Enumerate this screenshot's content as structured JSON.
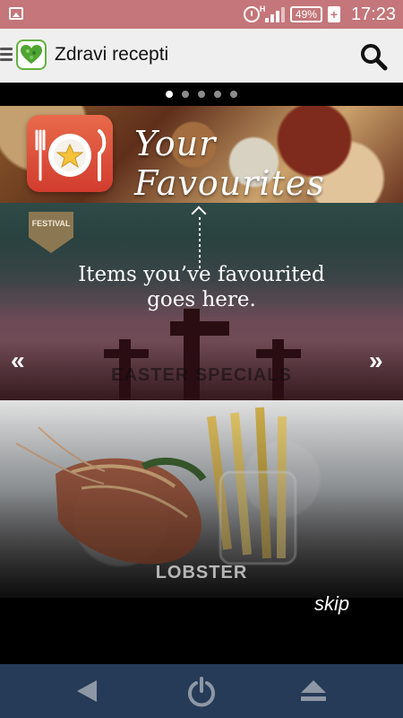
{
  "status_bar": {
    "time": "17:23",
    "battery_percent": "49%",
    "network_type": "H",
    "icons": [
      "image-notification-icon",
      "alarm-icon",
      "signal-icon",
      "battery-icon",
      "charging-icon"
    ]
  },
  "app_bar": {
    "title": "Zdravi recepti",
    "icons": [
      "menu-icon",
      "app-logo-icon",
      "search-icon"
    ]
  },
  "carousel": {
    "page_count": 5,
    "active_index": 0
  },
  "banner": {
    "title": "Your Favourites",
    "icon": "favorite-plate-star-icon"
  },
  "overlay": {
    "message": "Items you’ve favourited goes here.",
    "icons": [
      "up-arrow-icon",
      "left-double-chevron-icon",
      "right-double-chevron-icon"
    ]
  },
  "cards": [
    {
      "badge": "FESTIVAL",
      "label": "EASTER SPECIALS"
    },
    {
      "label": "LOBSTER"
    }
  ],
  "skip_label": "skip",
  "nav_bar": {
    "icons": [
      "back-icon",
      "power-icon",
      "eject-icon"
    ]
  },
  "colors": {
    "status_bar": "#c4767a",
    "app_bar": "#efefef",
    "nav_bar": "#263b57",
    "brand_green": "#63b140",
    "banner_icon_red": "#d23c2e"
  }
}
